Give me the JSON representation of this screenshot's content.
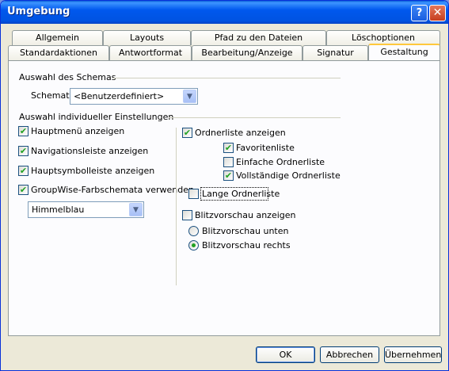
{
  "window": {
    "title": "Umgebung",
    "help_label": "?",
    "close_label": "✕"
  },
  "tabs": {
    "back_row": [
      "Allgemein",
      "Layouts",
      "Pfad zu den Dateien",
      "Löschoptionen"
    ],
    "front_row": [
      "Standardaktionen",
      "Antwortformat",
      "Bearbeitung/Anzeige",
      "Signatur",
      "Gestaltung"
    ],
    "active": "Gestaltung"
  },
  "schema_group": {
    "title": "Auswahl des Schemas",
    "label": "Schemata:",
    "value": "<Benutzerdefiniert>"
  },
  "individual_group": {
    "title": "Auswahl individueller Einstellungen",
    "left": [
      {
        "label": "Hauptmenü anzeigen",
        "checked": true
      },
      {
        "label": "Navigationsleiste anzeigen",
        "checked": true
      },
      {
        "label": "Hauptsymbolleiste anzeigen",
        "checked": true
      },
      {
        "label": "GroupWise-Farbschemata verwenden",
        "checked": true
      }
    ],
    "color_scheme_value": "Himmelblau",
    "folder_list": {
      "label": "Ordnerliste anzeigen",
      "checked": true
    },
    "folder_options": [
      {
        "label": "Favoritenliste",
        "checked": true
      },
      {
        "label": "Einfache Ordnerliste",
        "checked": false
      },
      {
        "label": "Vollständige Ordnerliste",
        "checked": true
      }
    ],
    "long_folder_list": {
      "label": "Lange Ordnerliste",
      "checked": false
    },
    "quick_viewer": {
      "label": "Blitzvorschau anzeigen",
      "checked": false
    },
    "quick_viewer_options": [
      {
        "label": "Blitzvorschau unten",
        "selected": false
      },
      {
        "label": "Blitzvorschau rechts",
        "selected": true
      }
    ]
  },
  "buttons": {
    "ok": "OK",
    "cancel": "Abbrechen",
    "apply": "Übernehmen"
  },
  "check_mark": "✔"
}
